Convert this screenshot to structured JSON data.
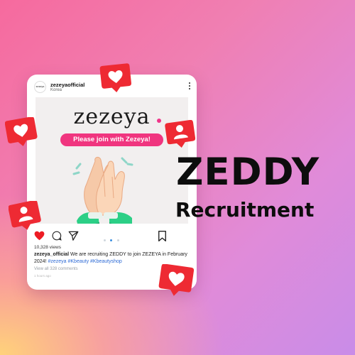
{
  "post": {
    "username": "zezeyaofficial",
    "location": "Korea",
    "avatar_text": "zezeya",
    "brand": "zezeya",
    "join_text": "Please join with Zezeya!",
    "views": "10,328 views",
    "caption_user": "zezeya_official",
    "caption_text": " We are recruiting ZEDDY to join ZEZEYA in February 2024!",
    "caption_tags": " #zezeya #Kbeauty #Kbeautyshop",
    "comments": "View all 328 comments",
    "time": "1 hours ago",
    "carousel": {
      "count": 3,
      "active": 1
    }
  },
  "headline": "ZEDDY",
  "subheadline": "Recruitment",
  "colors": {
    "accent_pink": "#f0357f",
    "notification_red": "#ee2a33",
    "hashtag_blue": "#2e6bd6",
    "sleeve_green": "#2ccf86"
  },
  "icons": [
    "heart-icon",
    "comment-icon",
    "share-icon",
    "bookmark-icon",
    "more-icon",
    "follower-icon"
  ]
}
